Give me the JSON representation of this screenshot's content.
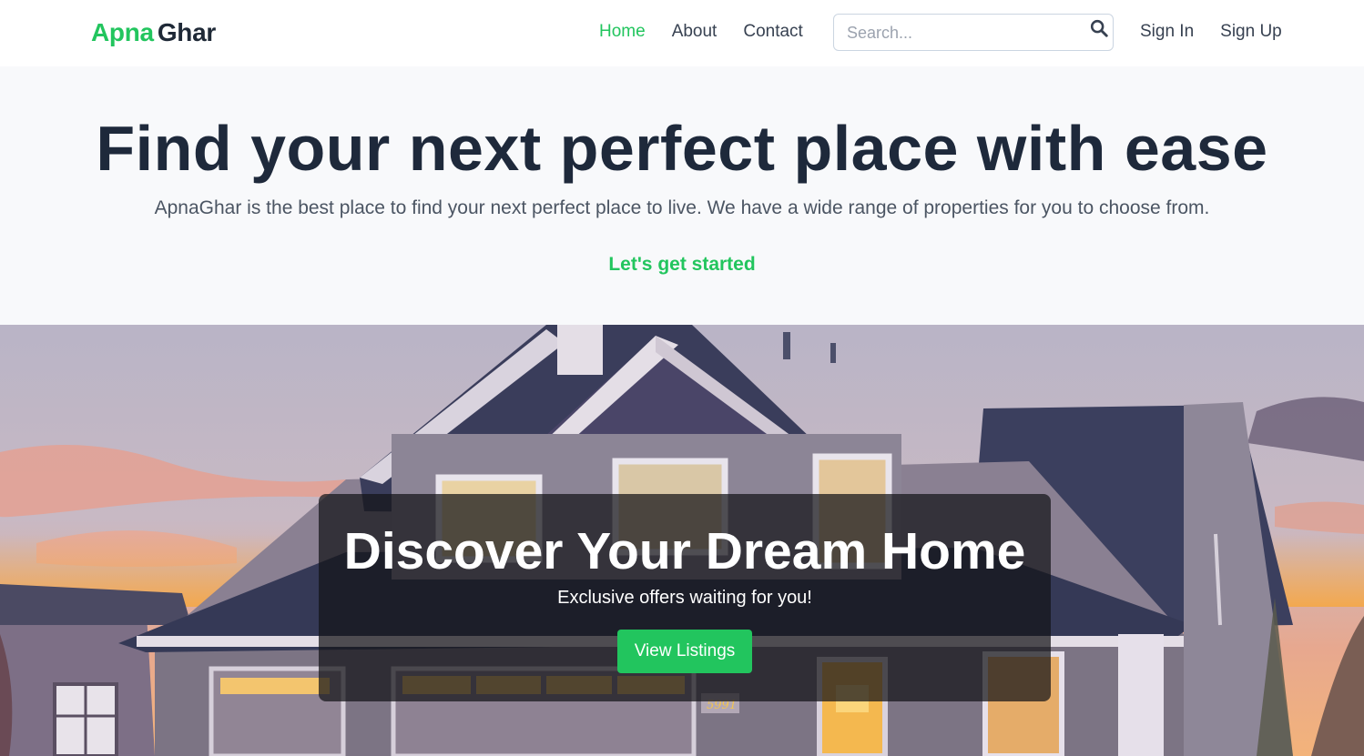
{
  "brand": {
    "part1": "Apna",
    "part2": "Ghar"
  },
  "nav": {
    "items": [
      {
        "label": "Home",
        "active": true
      },
      {
        "label": "About",
        "active": false
      },
      {
        "label": "Contact",
        "active": false
      }
    ],
    "search_placeholder": "Search...",
    "sign_in": "Sign In",
    "sign_up": "Sign Up"
  },
  "hero": {
    "title": "Find your next perfect place with ease",
    "subtitle": "ApnaGhar is the best place to find your next perfect place to live. We have a wide range of properties for you to choose from.",
    "cta": "Let's get started"
  },
  "banner": {
    "title": "Discover Your Dream Home",
    "subtitle": "Exclusive offers waiting for you!",
    "button": "View Listings",
    "house_number": "5991"
  },
  "colors": {
    "accent": "#22c55e",
    "heading": "#1e293b",
    "hero_bg": "#f8f9fb"
  },
  "icons": {
    "search": "search-icon"
  }
}
